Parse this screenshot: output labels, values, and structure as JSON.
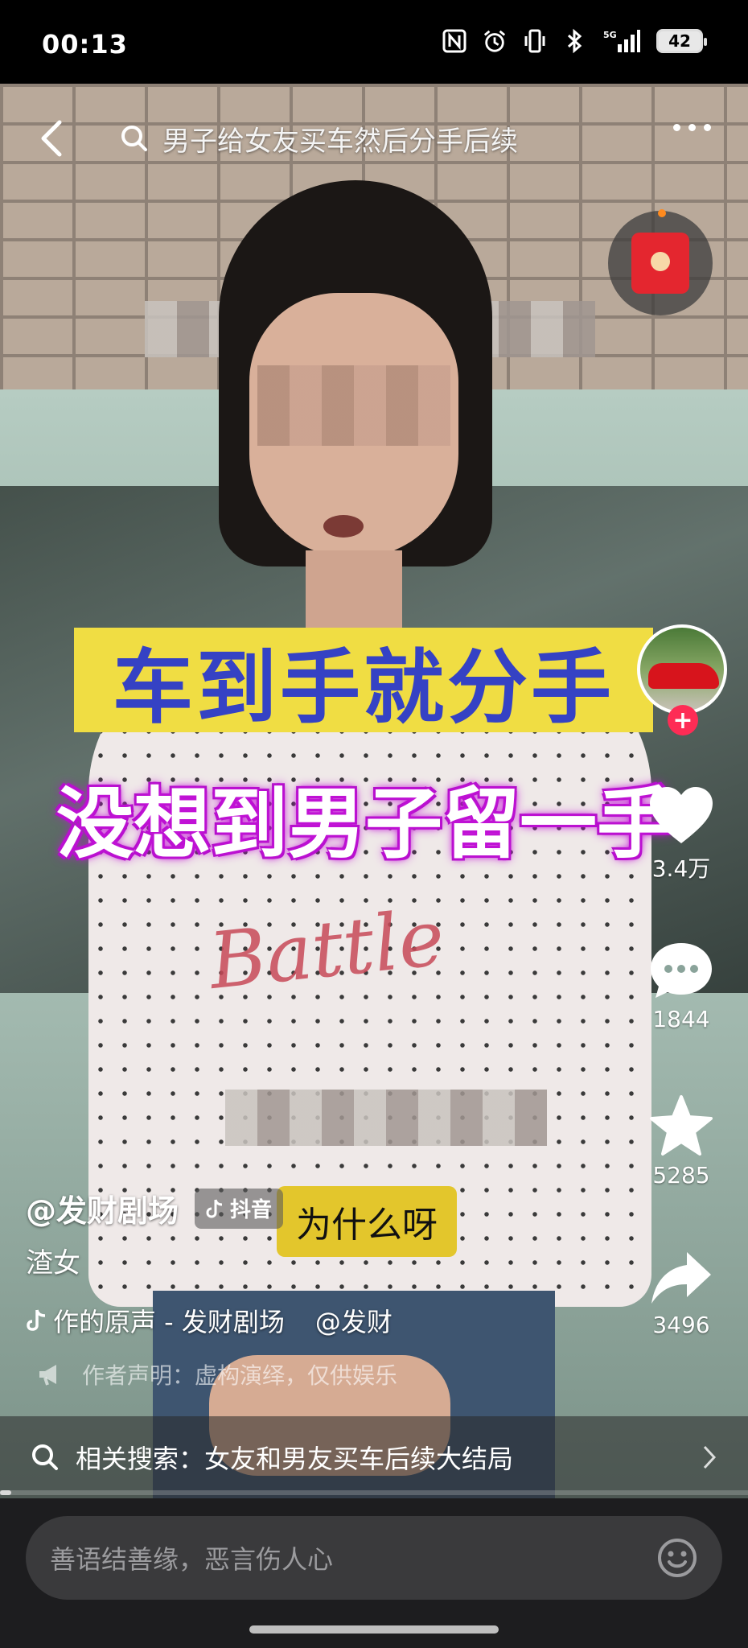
{
  "status_bar": {
    "time": "00:13",
    "network": "5G",
    "battery": "42"
  },
  "top_bar": {
    "search_query": "男子给女友买车然后分手后续"
  },
  "video": {
    "caption_line_1": "车到手就分手",
    "caption_line_2": "没想到男子留一手",
    "subtitle": "为什么呀",
    "shirt_print": "Battle"
  },
  "actions": {
    "likes": "3.4万",
    "comments": "1844",
    "favorites": "5285",
    "shares": "3496"
  },
  "info": {
    "author": "@发财剧场",
    "platform_badge": "抖音",
    "description": "渣女",
    "music": "作的原声 - 发财剧场",
    "music_mention": "@发财",
    "disclaimer": "作者声明：虚构演绎，仅供娱乐"
  },
  "related_search": {
    "label": "相关搜索：女友和男友买车后续大结局"
  },
  "progress": 0.015,
  "comment_bar": {
    "placeholder": "善语结善缘，恶言伤人心"
  },
  "colors": {
    "like_accent": "#fe2c55",
    "caption_yellow": "#f0dd43",
    "caption_blue": "#3542c4",
    "caption_purple": "#c414d8"
  }
}
